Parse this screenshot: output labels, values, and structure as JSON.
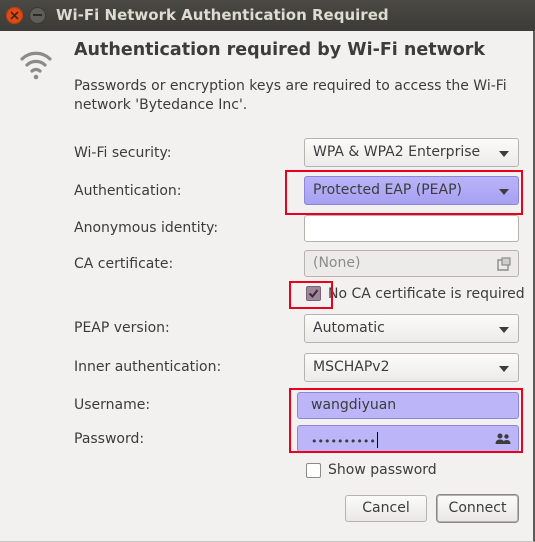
{
  "window": {
    "title": "Wi-Fi Network Authentication Required"
  },
  "heading": "Authentication required by Wi-Fi network",
  "description": "Passwords or encryption keys are required to access the Wi-Fi network 'Bytedance Inc'.",
  "fields": {
    "wifi_security": {
      "label": "Wi-Fi security:",
      "value": "WPA & WPA2 Enterprise"
    },
    "authentication": {
      "label": "Authentication:",
      "value": "Protected EAP (PEAP)"
    },
    "anonymous_identity": {
      "label": "Anonymous identity:",
      "value": ""
    },
    "ca_certificate": {
      "label": "CA certificate:",
      "value": "(None)"
    },
    "no_ca_required": {
      "label": "No CA certificate is required",
      "checked": true
    },
    "peap_version": {
      "label": "PEAP version:",
      "value": "Automatic"
    },
    "inner_auth": {
      "label": "Inner authentication:",
      "value": "MSCHAPv2"
    },
    "username": {
      "label": "Username:",
      "value": "wangdiyuan"
    },
    "password": {
      "label": "Password:",
      "value": "••••••••••"
    },
    "show_password": {
      "label": "Show password",
      "checked": false
    }
  },
  "buttons": {
    "cancel": "Cancel",
    "connect": "Connect"
  },
  "icons": {
    "wifi": "wifi-icon",
    "close": "close-icon",
    "minimize": "minimize-icon",
    "certificate": "certificate-icon",
    "people": "people-icon"
  },
  "colors": {
    "highlight": "#b9b3f8",
    "annotation": "#e8001c",
    "titlebar": "#3c3b37",
    "close": "#df4a16"
  }
}
